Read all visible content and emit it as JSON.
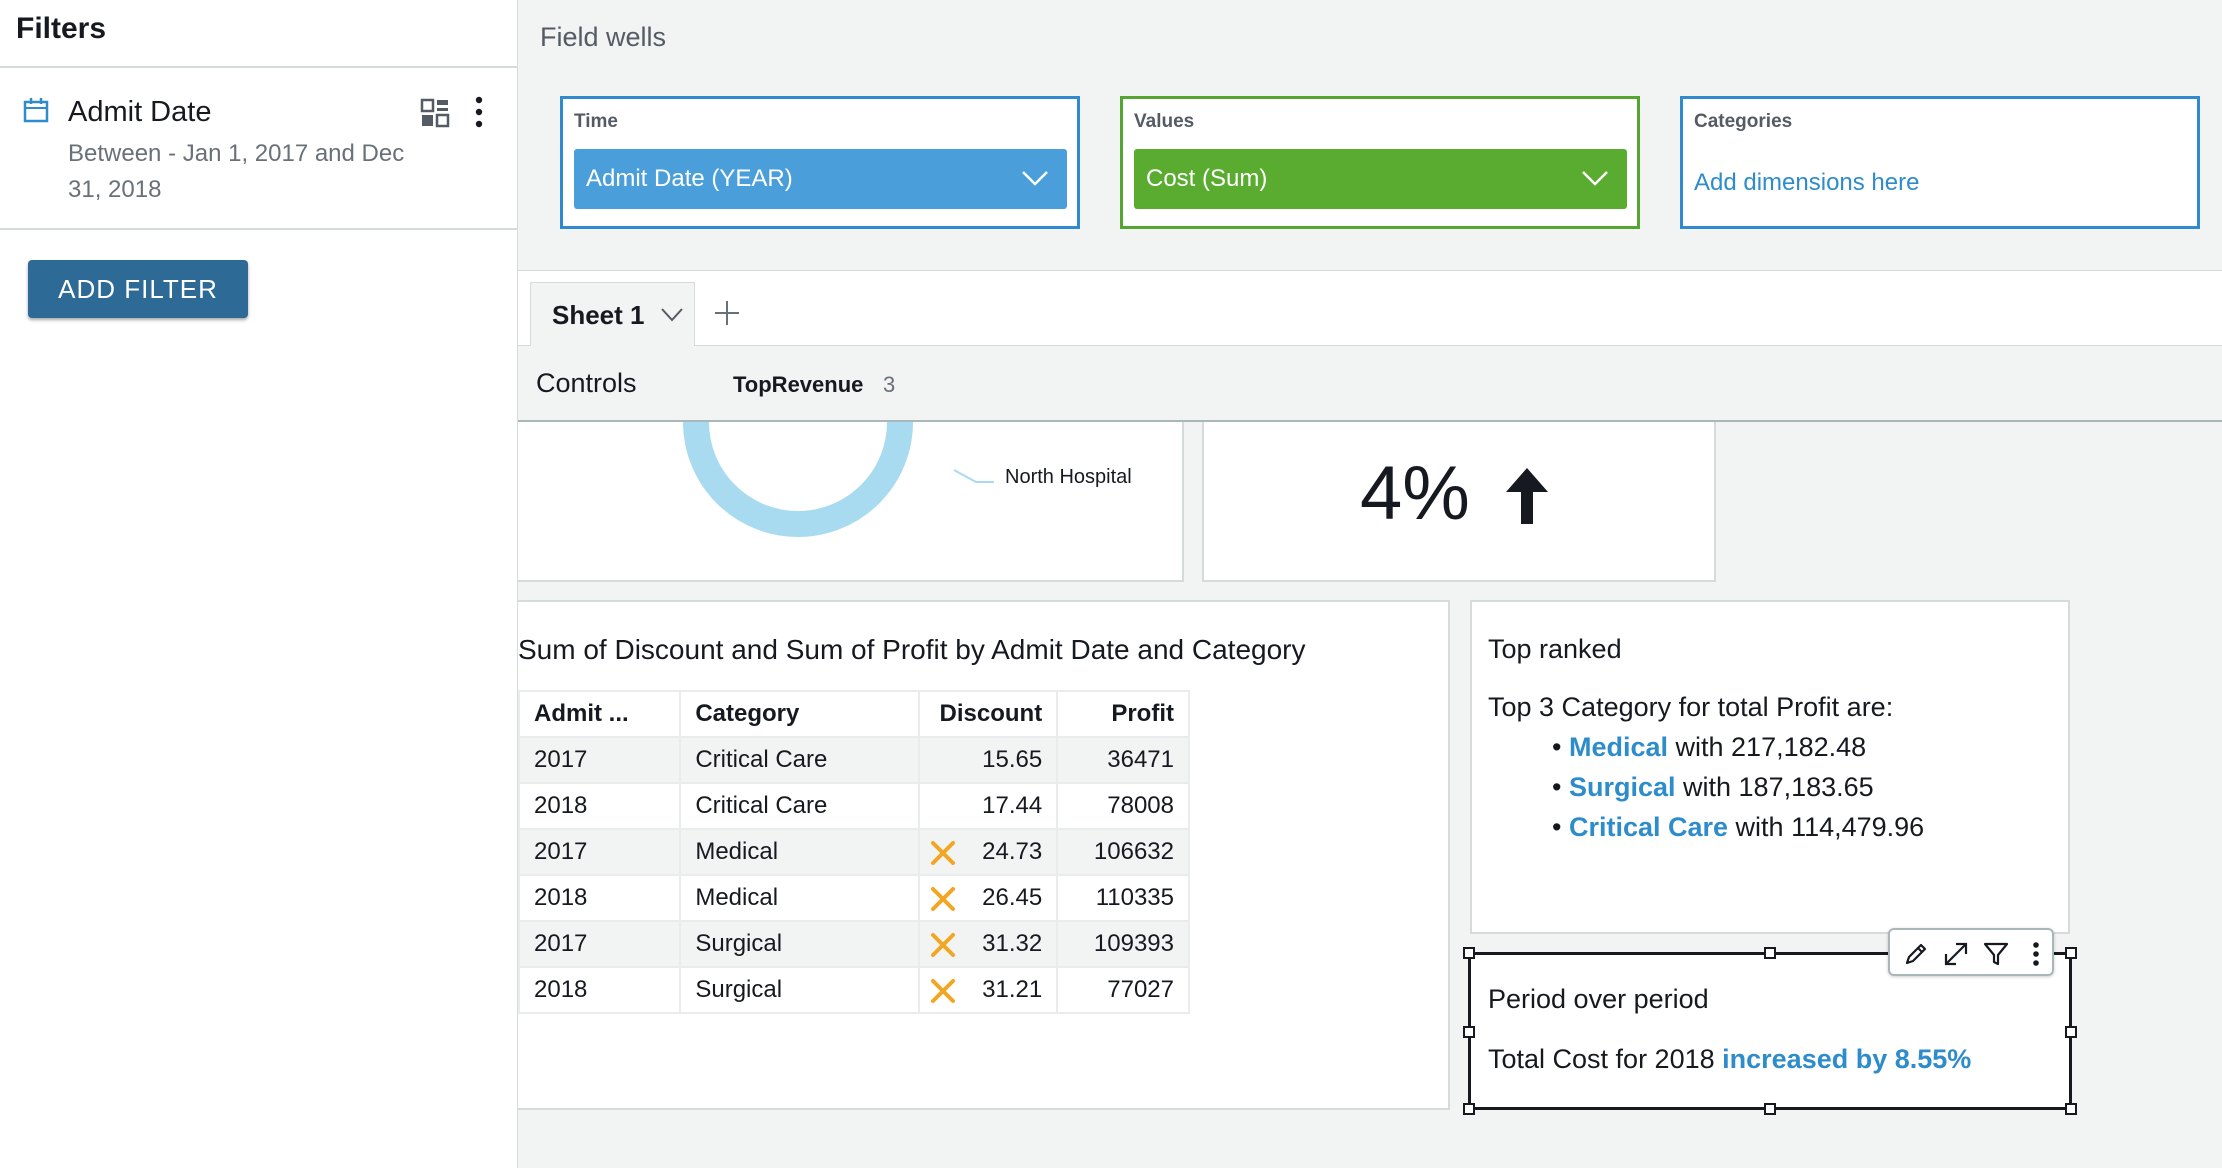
{
  "filters": {
    "title": "Filters",
    "items": [
      {
        "name": "Admit Date",
        "description": "Between - Jan 1, 2017 and Dec 31, 2018"
      }
    ],
    "add_button": "ADD FILTER"
  },
  "field_wells": {
    "title": "Field wells",
    "time": {
      "label": "Time",
      "value": "Admit Date (YEAR)"
    },
    "values": {
      "label": "Values",
      "value": "Cost (Sum)"
    },
    "categories": {
      "label": "Categories",
      "placeholder": "Add dimensions here"
    }
  },
  "sheets": {
    "active": "Sheet 1"
  },
  "controls": {
    "label": "Controls",
    "parameter": "TopRevenue",
    "parameter_value": "3"
  },
  "donut_visual": {
    "label": "North Hospital"
  },
  "kpi_visual": {
    "value": "4%",
    "direction": "up"
  },
  "table_visual": {
    "title": "Sum of Discount and Sum of Profit by Admit Date and Category",
    "columns": [
      "Admit ...",
      "Category",
      "Discount",
      "Profit"
    ],
    "rows": [
      {
        "year": "2017",
        "category": "Critical Care",
        "discount": "15.65",
        "profit": "36471",
        "flag": false
      },
      {
        "year": "2018",
        "category": "Critical Care",
        "discount": "17.44",
        "profit": "78008",
        "flag": false
      },
      {
        "year": "2017",
        "category": "Medical",
        "discount": "24.73",
        "profit": "106632",
        "flag": true
      },
      {
        "year": "2018",
        "category": "Medical",
        "discount": "26.45",
        "profit": "110335",
        "flag": true
      },
      {
        "year": "2017",
        "category": "Surgical",
        "discount": "31.32",
        "profit": "109393",
        "flag": true
      },
      {
        "year": "2018",
        "category": "Surgical",
        "discount": "31.21",
        "profit": "77027",
        "flag": true
      }
    ]
  },
  "insight_top_ranked": {
    "title": "Top ranked",
    "intro": "Top 3 Category for total Profit are:",
    "items": [
      {
        "name": "Medical",
        "text": " with 217,182.48"
      },
      {
        "name": "Surgical",
        "text": " with 187,183.65"
      },
      {
        "name": "Critical Care",
        "text": " with 114,479.96"
      }
    ]
  },
  "insight_period": {
    "title": "Period over period",
    "text": "Total Cost for 2018 ",
    "highlight": "increased by 8.55%"
  },
  "colors": {
    "time_well": "#2f8ad1",
    "time_pill": "#4a9fdb",
    "values_well": "#55a630",
    "values_pill": "#5aac30",
    "link": "#2e8ccb",
    "add_filter": "#2e6a96",
    "donut": "#a9dbf0",
    "warning_x": "#f2a623"
  },
  "icons": [
    "calendar-icon",
    "grid-icon",
    "more-vertical-icon",
    "chevron-down-icon",
    "plus-icon",
    "arrow-up-icon",
    "x-icon",
    "pencil-icon",
    "expand-icon",
    "filter-icon"
  ]
}
